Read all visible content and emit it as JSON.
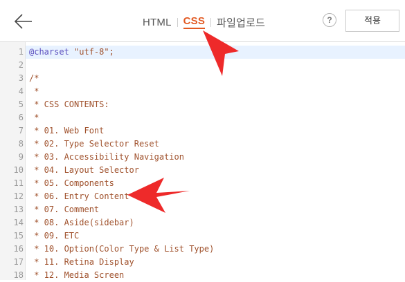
{
  "header": {
    "tabs": [
      {
        "label": "HTML",
        "active": false
      },
      {
        "label": "CSS",
        "active": true
      },
      {
        "label": "파일업로드",
        "active": false
      }
    ],
    "help_label": "?",
    "apply_label": "적용"
  },
  "editor": {
    "current_line": 1,
    "lines": [
      {
        "num": "1",
        "keyword": "@charset",
        "text": " \"utf-8\";"
      },
      {
        "num": "2",
        "keyword": "",
        "text": ""
      },
      {
        "num": "3",
        "keyword": "",
        "text": "/*"
      },
      {
        "num": "4",
        "keyword": "",
        "text": " *"
      },
      {
        "num": "5",
        "keyword": "",
        "text": " * CSS CONTENTS:"
      },
      {
        "num": "6",
        "keyword": "",
        "text": " *"
      },
      {
        "num": "7",
        "keyword": "",
        "text": " * 01. Web Font"
      },
      {
        "num": "8",
        "keyword": "",
        "text": " * 02. Type Selector Reset"
      },
      {
        "num": "9",
        "keyword": "",
        "text": " * 03. Accessibility Navigation"
      },
      {
        "num": "10",
        "keyword": "",
        "text": " * 04. Layout Selector"
      },
      {
        "num": "11",
        "keyword": "",
        "text": " * 05. Components"
      },
      {
        "num": "12",
        "keyword": "",
        "text": " * 06. Entry Content"
      },
      {
        "num": "13",
        "keyword": "",
        "text": " * 07. Comment"
      },
      {
        "num": "14",
        "keyword": "",
        "text": " * 08. Aside(sidebar)"
      },
      {
        "num": "15",
        "keyword": "",
        "text": " * 09. ETC"
      },
      {
        "num": "16",
        "keyword": "",
        "text": " * 10. Option(Color Type & List Type)"
      },
      {
        "num": "17",
        "keyword": "",
        "text": " * 11. Retina Display"
      },
      {
        "num": "18",
        "keyword": "",
        "text": " * 12. Media Screen"
      }
    ]
  },
  "colors": {
    "accent": "#e25a23",
    "annotation_arrow": "#ee2a2a",
    "keyword": "#5b4fbf",
    "comment": "#a0522d"
  }
}
